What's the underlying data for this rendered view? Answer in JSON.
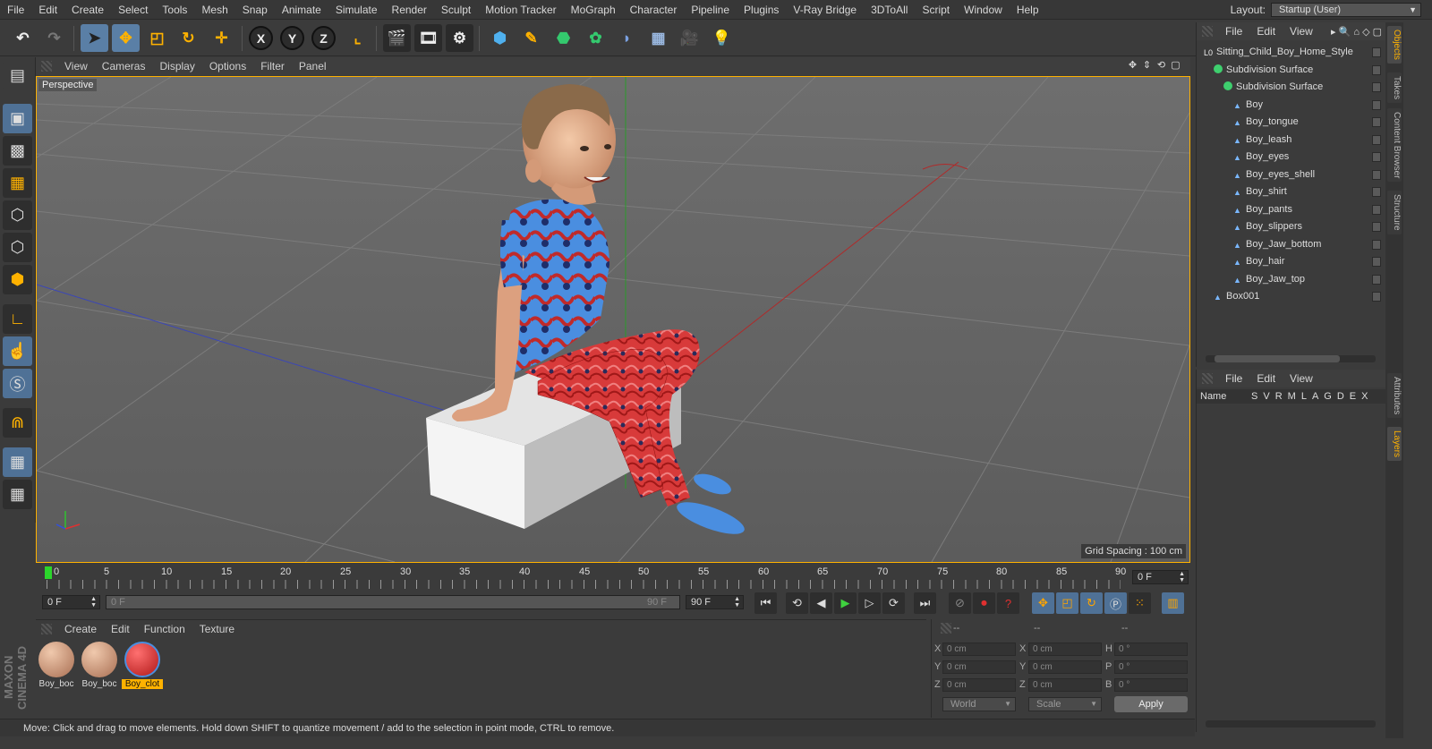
{
  "menubar": {
    "items": [
      "File",
      "Edit",
      "Create",
      "Select",
      "Tools",
      "Mesh",
      "Snap",
      "Animate",
      "Simulate",
      "Render",
      "Sculpt",
      "Motion Tracker",
      "MoGraph",
      "Character",
      "Pipeline",
      "Plugins",
      "V-Ray Bridge",
      "3DToAll",
      "Script",
      "Window",
      "Help"
    ],
    "layout_label": "Layout:",
    "layout_value": "Startup (User)"
  },
  "toolbar": {
    "undo": "undo-icon",
    "axis_x": "X",
    "axis_y": "Y",
    "axis_z": "Z"
  },
  "viewport": {
    "menu": [
      "View",
      "Cameras",
      "Display",
      "Options",
      "Filter",
      "Panel"
    ],
    "label": "Perspective",
    "grid_spacing": "Grid Spacing : 100 cm",
    "axis_colors": {
      "x": "#e03030",
      "y": "#30c030",
      "z": "#3050e0"
    }
  },
  "timeline": {
    "ticks": [
      "0",
      "5",
      "10",
      "15",
      "20",
      "25",
      "30",
      "35",
      "40",
      "45",
      "50",
      "55",
      "60",
      "65",
      "70",
      "75",
      "80",
      "85",
      "90"
    ],
    "end_field": "0 F",
    "start_frame": "0 F",
    "range_start": "0 F",
    "range_end": "90 F",
    "max_frame": "90 F"
  },
  "materials": {
    "menu": [
      "Create",
      "Edit",
      "Function",
      "Texture"
    ],
    "items": [
      {
        "name": "Boy_boc",
        "color": "#c99479"
      },
      {
        "name": "Boy_boc",
        "color": "#c99479"
      },
      {
        "name": "Boy_clot",
        "color": "#d83a3a"
      }
    ]
  },
  "coordinates": {
    "header": [
      "--",
      "--",
      "--"
    ],
    "rows": [
      {
        "a": "X",
        "av": "0 cm",
        "b": "X",
        "bv": "0 cm",
        "c": "H",
        "cv": "0 °"
      },
      {
        "a": "Y",
        "av": "0 cm",
        "b": "Y",
        "bv": "0 cm",
        "c": "P",
        "cv": "0 °"
      },
      {
        "a": "Z",
        "av": "0 cm",
        "b": "Z",
        "bv": "0 cm",
        "c": "B",
        "cv": "0 °"
      }
    ],
    "mode": "World",
    "scale": "Scale",
    "apply": "Apply"
  },
  "objects": {
    "menu": [
      "File",
      "Edit",
      "View"
    ],
    "tree": [
      {
        "name": "Sitting_Child_Boy_Home_Style",
        "depth": 0
      },
      {
        "name": "Subdivision Surface",
        "depth": 1
      },
      {
        "name": "Subdivision Surface",
        "depth": 2
      },
      {
        "name": "Boy",
        "depth": 3
      },
      {
        "name": "Boy_tongue",
        "depth": 3
      },
      {
        "name": "Boy_leash",
        "depth": 3
      },
      {
        "name": "Boy_eyes",
        "depth": 3
      },
      {
        "name": "Boy_eyes_shell",
        "depth": 3
      },
      {
        "name": "Boy_shirt",
        "depth": 3
      },
      {
        "name": "Boy_pants",
        "depth": 3
      },
      {
        "name": "Boy_slippers",
        "depth": 3
      },
      {
        "name": "Boy_Jaw_bottom",
        "depth": 3
      },
      {
        "name": "Boy_hair",
        "depth": 3
      },
      {
        "name": "Boy_Jaw_top",
        "depth": 3
      },
      {
        "name": "Box001",
        "depth": 1
      }
    ]
  },
  "layers": {
    "menu": [
      "File",
      "Edit",
      "View"
    ],
    "columns": [
      "Name",
      "S",
      "V",
      "R",
      "M",
      "L",
      "A",
      "G",
      "D",
      "E",
      "X"
    ]
  },
  "side_tabs": [
    "Objects",
    "Takes",
    "Content Browser",
    "Structure",
    "Attributes",
    "Layers"
  ],
  "status": "Move: Click and drag to move elements. Hold down SHIFT to quantize movement / add to the selection in point mode, CTRL to remove.",
  "brand": "MAXON CINEMA 4D"
}
